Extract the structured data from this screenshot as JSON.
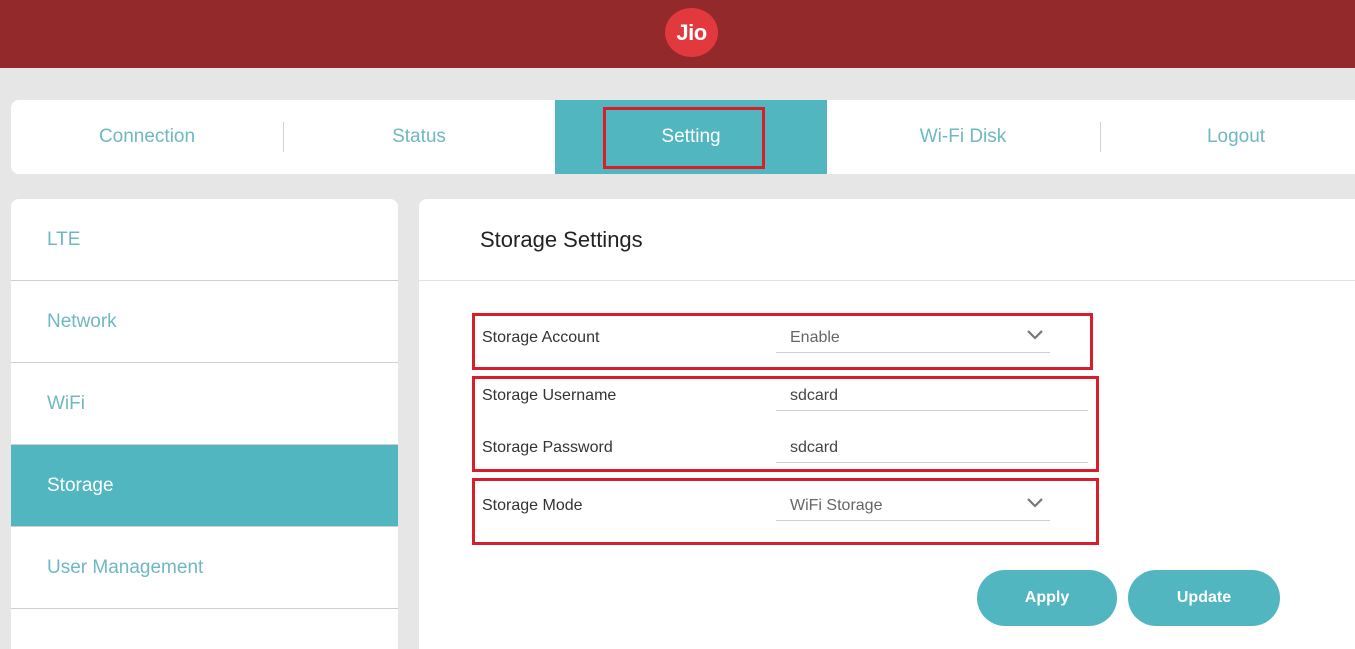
{
  "brand": {
    "logo_text": "Jio",
    "header_color": "#93292a",
    "logo_color": "#e1393d",
    "accent": "#52b6c1",
    "highlight": "#d81e2a"
  },
  "topnav": {
    "tabs": [
      {
        "label": "Connection",
        "active": false
      },
      {
        "label": "Status",
        "active": false
      },
      {
        "label": "Setting",
        "active": true
      },
      {
        "label": "Wi-Fi  Disk",
        "active": false
      },
      {
        "label": "Logout",
        "active": false
      }
    ]
  },
  "sidebar": {
    "items": [
      {
        "label": "LTE",
        "active": false
      },
      {
        "label": "Network",
        "active": false
      },
      {
        "label": "WiFi",
        "active": false
      },
      {
        "label": "Storage",
        "active": true
      },
      {
        "label": "User  Management",
        "active": false
      }
    ]
  },
  "main": {
    "title": "Storage  Settings",
    "storage_account": {
      "label": "Storage  Account",
      "value": "Enable"
    },
    "storage_username": {
      "label": "Storage  Username",
      "value": "sdcard"
    },
    "storage_password": {
      "label": "Storage  Password",
      "value": "sdcard"
    },
    "storage_mode": {
      "label": "Storage  Mode",
      "value": "WiFi  Storage"
    },
    "apply_label": "Apply",
    "update_label": "Update"
  },
  "icons": {
    "dropdown": "chevron-down-icon"
  }
}
